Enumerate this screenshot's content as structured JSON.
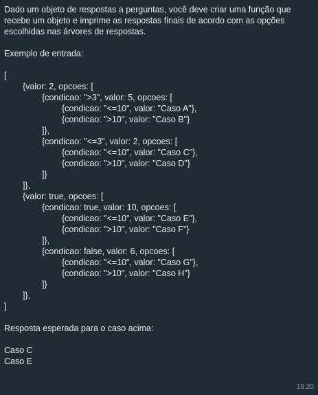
{
  "message": {
    "intro": "Dado um objeto de respostas a perguntas, você deve criar uma função que recebe um objeto e imprime as respostas finais de acordo com as opções escolhidas nas árvores de respostas.",
    "example_label": "Exemplo de entrada:",
    "code_lines": [
      "[",
      "{valor: 2, opcoes: [",
      "{condicao: \">3\", valor: 5, opcoes: [",
      "{condicao: \"<=10\", valor: \"Caso A\"},",
      "{condicao: \">10\", valor: \"Caso B\"}",
      "]},",
      "{condicao: \"<=3\", valor: 2, opcoes: [",
      "{condicao: \"<=10\", valor: \"Caso C\"},",
      "{condicao: \">10\", valor: \"Caso D\"}",
      "]}",
      "]},",
      "{valor: true, opcoes: [",
      "{condicao: true, valor: 10, opcoes: [",
      "{condicao: \"<=10\", valor: \"Caso E\"},",
      "{condicao: \">10\", valor: \"Caso F\"}",
      "]},",
      "{condicao: false, valor: 6, opcoes: [",
      "{condicao: \"<=10\", valor: \"Caso G\"},",
      "{condicao: \">10\", valor: \"Caso H\"}",
      "]}",
      "]},",
      "]"
    ],
    "expected_label": "Resposta esperada para o caso acima:",
    "answers": [
      "Caso C",
      "Caso E"
    ],
    "timestamp": "18:20"
  }
}
